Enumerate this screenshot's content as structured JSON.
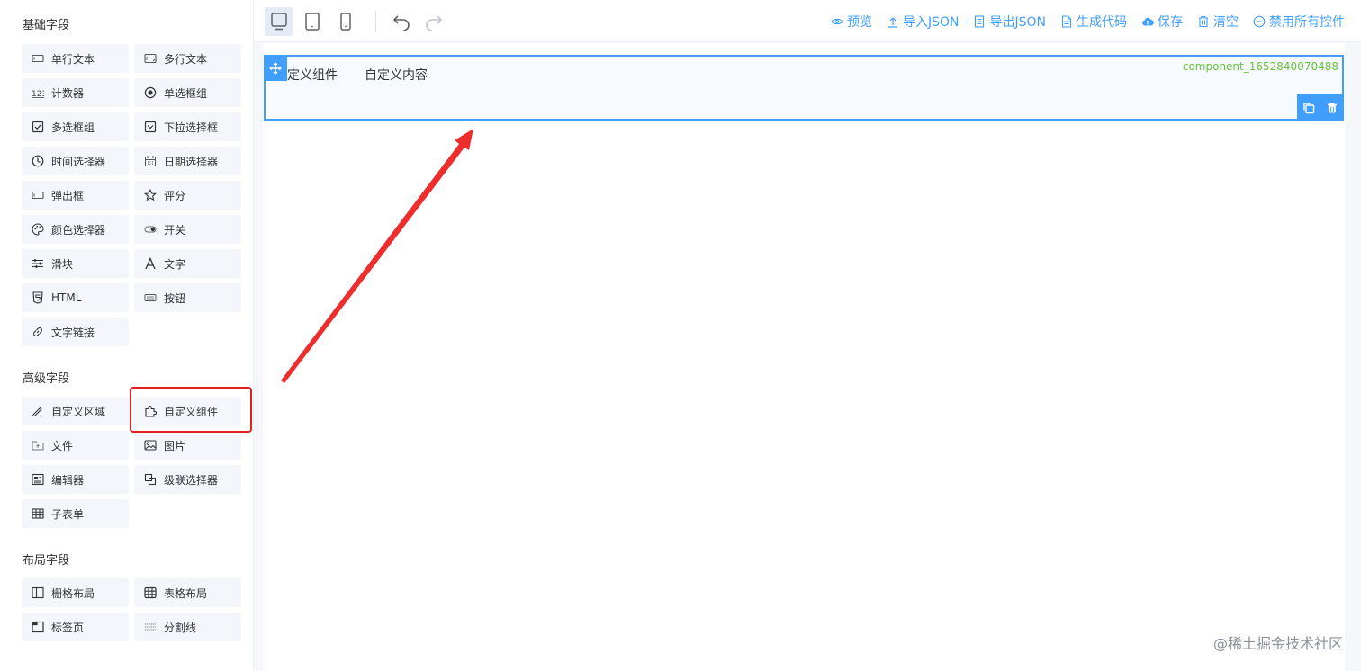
{
  "sidebar": {
    "basic_title": "基础字段",
    "advanced_title": "高级字段",
    "layout_title": "布局字段",
    "basic_items": [
      {
        "label": "单行文本",
        "icon": "input-icon"
      },
      {
        "label": "多行文本",
        "icon": "textarea-icon"
      },
      {
        "label": "计数器",
        "icon": "number-icon"
      },
      {
        "label": "单选框组",
        "icon": "radio-icon"
      },
      {
        "label": "多选框组",
        "icon": "checkbox-icon"
      },
      {
        "label": "下拉选择框",
        "icon": "select-icon"
      },
      {
        "label": "时间选择器",
        "icon": "clock-icon"
      },
      {
        "label": "日期选择器",
        "icon": "calendar-icon"
      },
      {
        "label": "弹出框",
        "icon": "dialog-icon"
      },
      {
        "label": "评分",
        "icon": "star-icon"
      },
      {
        "label": "颜色选择器",
        "icon": "palette-icon"
      },
      {
        "label": "开关",
        "icon": "switch-icon"
      },
      {
        "label": "滑块",
        "icon": "slider-icon"
      },
      {
        "label": "文字",
        "icon": "text-icon"
      },
      {
        "label": "HTML",
        "icon": "html-icon"
      },
      {
        "label": "按钮",
        "icon": "button-icon"
      },
      {
        "label": "文字链接",
        "icon": "link-icon"
      }
    ],
    "advanced_items": [
      {
        "label": "自定义区域",
        "icon": "edit-area-icon"
      },
      {
        "label": "自定义组件",
        "icon": "puzzle-icon"
      },
      {
        "label": "文件",
        "icon": "folder-icon"
      },
      {
        "label": "图片",
        "icon": "image-icon"
      },
      {
        "label": "编辑器",
        "icon": "editor-icon"
      },
      {
        "label": "级联选择器",
        "icon": "cascader-icon"
      },
      {
        "label": "子表单",
        "icon": "table-icon"
      }
    ],
    "layout_items": [
      {
        "label": "栅格布局",
        "icon": "grid-icon"
      },
      {
        "label": "表格布局",
        "icon": "table-layout-icon"
      },
      {
        "label": "标签页",
        "icon": "tabs-icon"
      },
      {
        "label": "分割线",
        "icon": "divider-icon"
      }
    ]
  },
  "toolbar": {
    "actions": [
      {
        "label": "预览",
        "icon": "eye-icon"
      },
      {
        "label": "导入JSON",
        "icon": "upload-icon"
      },
      {
        "label": "导出JSON",
        "icon": "export-icon"
      },
      {
        "label": "生成代码",
        "icon": "code-file-icon"
      },
      {
        "label": "保存",
        "icon": "cloud-upload-icon"
      },
      {
        "label": "清空",
        "icon": "trash-icon"
      },
      {
        "label": "禁用所有控件",
        "icon": "minus-circle-icon"
      }
    ]
  },
  "widget": {
    "label": "自定义组件",
    "content": "自定义内容",
    "id": "component_1652840070488"
  },
  "watermark": "@稀土掘金技术社区",
  "colors": {
    "accent": "#409eff",
    "highlight": "#e02020",
    "id_text": "#67c23a"
  }
}
